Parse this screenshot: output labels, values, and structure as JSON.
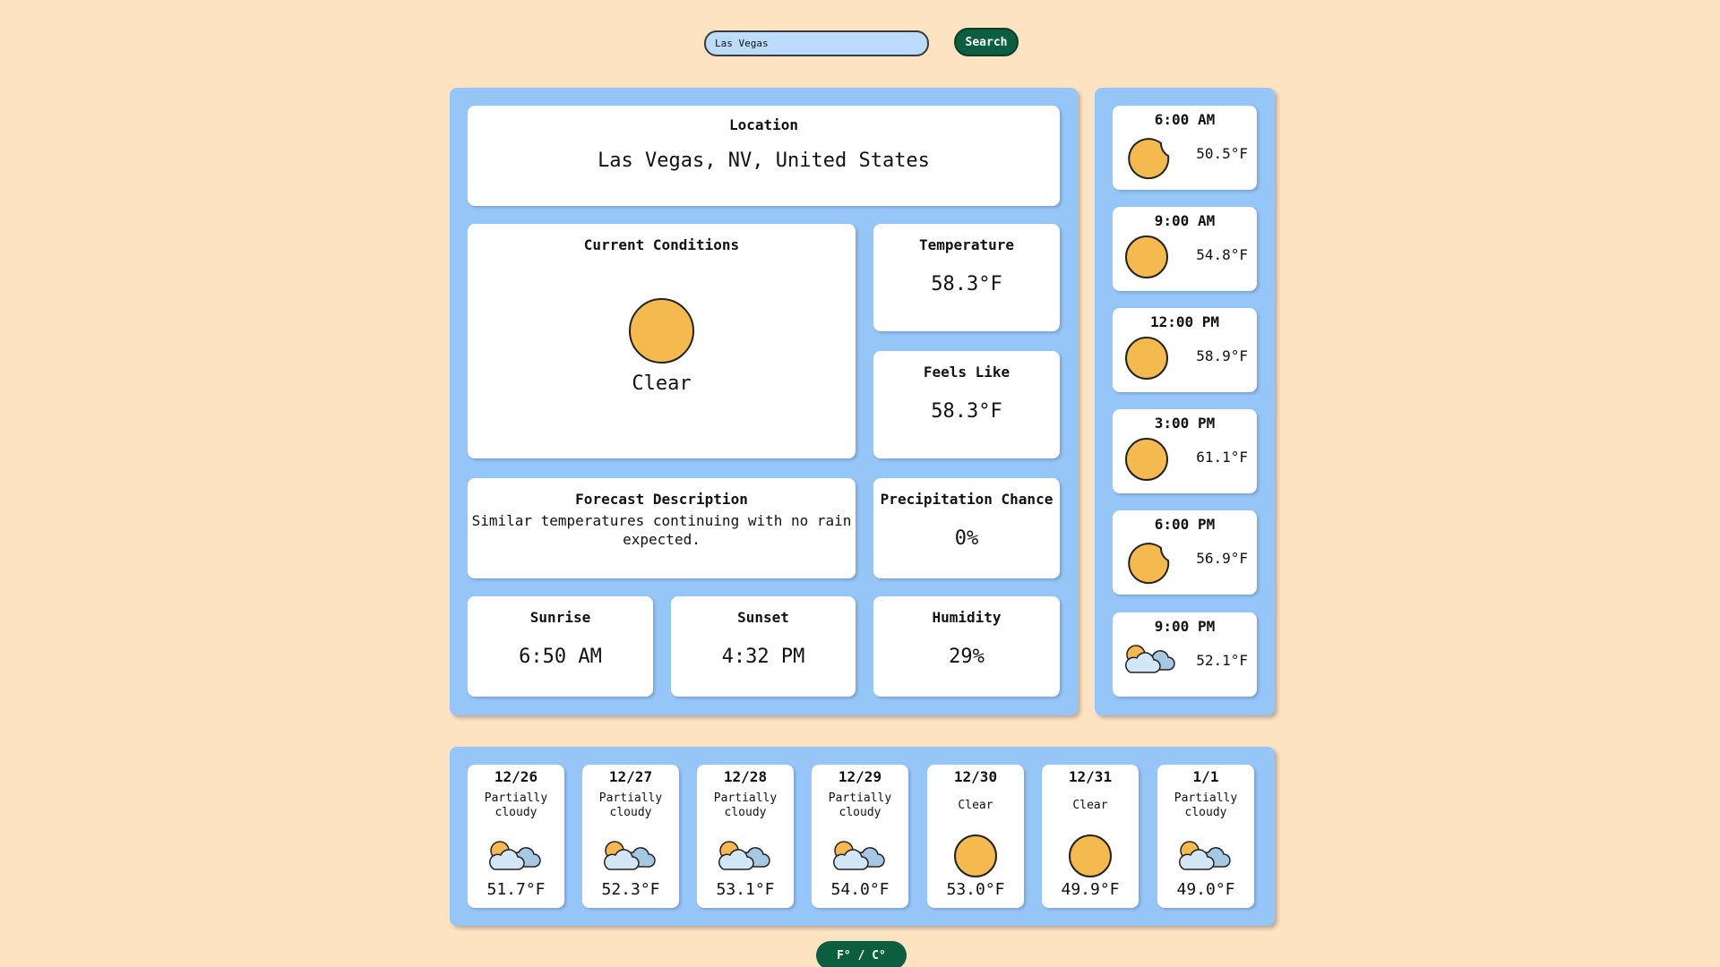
{
  "search": {
    "value": "Las Vegas",
    "button_label": "Search"
  },
  "location": {
    "title": "Location",
    "value": "Las Vegas, NV, United States"
  },
  "current": {
    "title": "Current Conditions",
    "condition": "Clear",
    "icon": "sun-icon"
  },
  "temperature": {
    "title": "Temperature",
    "value": "58.3°F"
  },
  "feels_like": {
    "title": "Feels Like",
    "value": "58.3°F"
  },
  "forecast": {
    "title": "Forecast Description",
    "value": "Similar temperatures continuing with no rain expected."
  },
  "precip": {
    "title": "Precipitation Chance",
    "value": "0%"
  },
  "sunrise": {
    "title": "Sunrise",
    "value": "6:50 AM"
  },
  "sunset": {
    "title": "Sunset",
    "value": "4:32 PM"
  },
  "humidity": {
    "title": "Humidity",
    "value": "29%"
  },
  "hourly": [
    {
      "time": "6:00 AM",
      "temp": "50.5°F",
      "icon": "moon-icon"
    },
    {
      "time": "9:00 AM",
      "temp": "54.8°F",
      "icon": "sun-icon"
    },
    {
      "time": "12:00 PM",
      "temp": "58.9°F",
      "icon": "sun-icon"
    },
    {
      "time": "3:00 PM",
      "temp": "61.1°F",
      "icon": "sun-icon"
    },
    {
      "time": "6:00 PM",
      "temp": "56.9°F",
      "icon": "moon-icon"
    },
    {
      "time": "9:00 PM",
      "temp": "52.1°F",
      "icon": "partly-cloudy-icon"
    }
  ],
  "daily": [
    {
      "date": "12/26",
      "condition": "Partially cloudy",
      "temp": "51.7°F",
      "icon": "partly-cloudy-icon"
    },
    {
      "date": "12/27",
      "condition": "Partially cloudy",
      "temp": "52.3°F",
      "icon": "partly-cloudy-icon"
    },
    {
      "date": "12/28",
      "condition": "Partially cloudy",
      "temp": "53.1°F",
      "icon": "partly-cloudy-icon"
    },
    {
      "date": "12/29",
      "condition": "Partially cloudy",
      "temp": "54.0°F",
      "icon": "partly-cloudy-icon"
    },
    {
      "date": "12/30",
      "condition": "Clear",
      "temp": "53.0°F",
      "icon": "sun-icon"
    },
    {
      "date": "12/31",
      "condition": "Clear",
      "temp": "49.9°F",
      "icon": "sun-icon"
    },
    {
      "date": "1/1",
      "condition": "Partially cloudy",
      "temp": "49.0°F",
      "icon": "partly-cloudy-icon"
    }
  ],
  "unit_toggle": {
    "label": "F° / C°"
  },
  "colors": {
    "background": "#fee3c3",
    "panel": "#96c5f8",
    "accent": "#0b5e3f",
    "sun": "#f4b94f"
  }
}
